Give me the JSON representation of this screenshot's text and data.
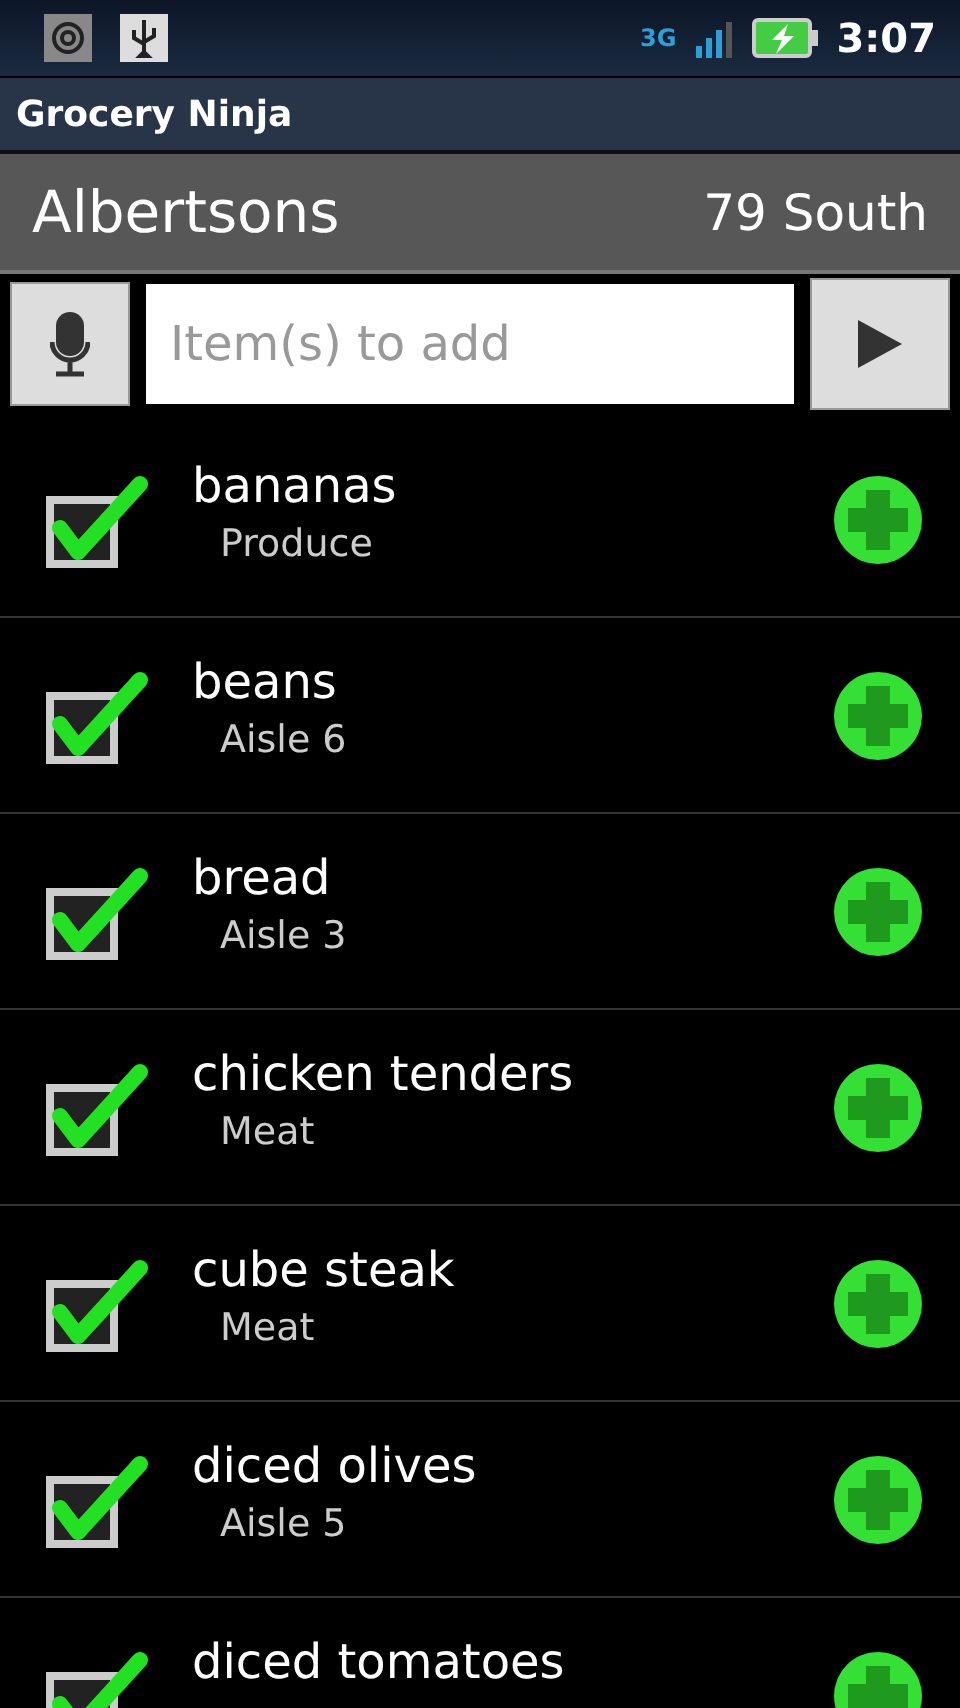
{
  "status_bar": {
    "network": "3G",
    "time": "3:07"
  },
  "window": {
    "title": "Grocery Ninja"
  },
  "store": {
    "name": "Albertsons",
    "location": "79 South"
  },
  "add_bar": {
    "placeholder": "Item(s) to add"
  },
  "items": [
    {
      "name": "bananas",
      "aisle": "Produce",
      "checked": true
    },
    {
      "name": "beans",
      "aisle": "Aisle 6",
      "checked": true
    },
    {
      "name": "bread",
      "aisle": "Aisle 3",
      "checked": true
    },
    {
      "name": "chicken tenders",
      "aisle": "Meat",
      "checked": true
    },
    {
      "name": "cube steak",
      "aisle": "Meat",
      "checked": true
    },
    {
      "name": "diced olives",
      "aisle": "Aisle 5",
      "checked": true
    },
    {
      "name": "diced tomatoes",
      "checked": true
    }
  ]
}
